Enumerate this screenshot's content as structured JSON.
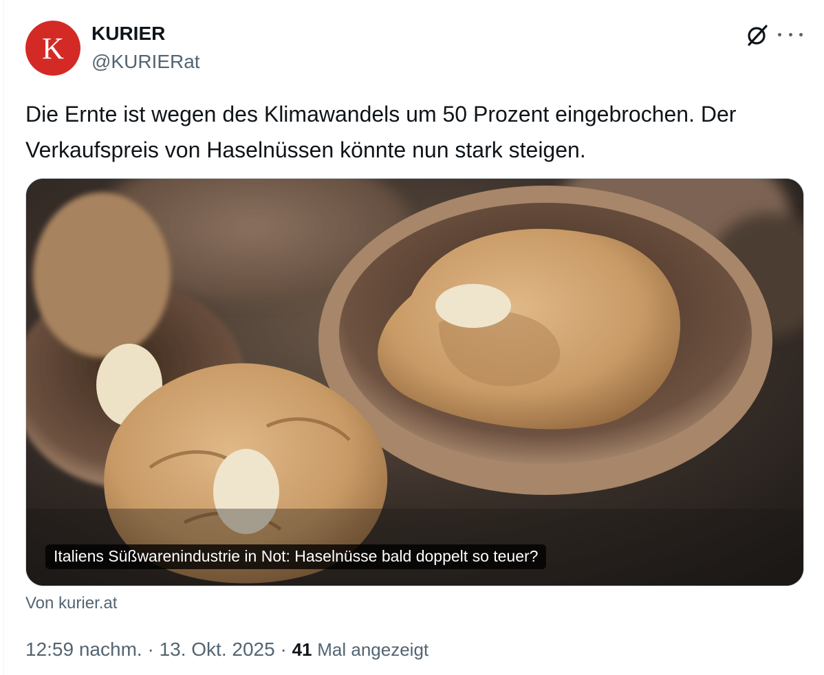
{
  "account": {
    "avatar_letter": "K",
    "avatar_color": "#d42a26",
    "name": "KURIER",
    "handle": "@KURIERat"
  },
  "icons": {
    "grok": "grok-icon",
    "more": "more-options-icon"
  },
  "tweet": {
    "text_line1": "Die Ernte ist wegen des Klimawandels um 50 Prozent eingebrochen. Der",
    "text_line2": "Verkaufspreis von Haselnüssen könnte nun stark steigen."
  },
  "card": {
    "image_subject": "walnuts",
    "caption": "Italiens Süßwarenindustrie in Not: Haselnüsse bald doppelt so teuer?",
    "source": "Von kurier.at"
  },
  "meta": {
    "time": "12:59 nachm.",
    "separator": "·",
    "date": "13. Okt. 2025",
    "views_count": "41",
    "views_label": "Mal angezeigt"
  },
  "colors": {
    "text": "#0f1419",
    "secondary": "#536471",
    "border": "#cfd9de"
  }
}
